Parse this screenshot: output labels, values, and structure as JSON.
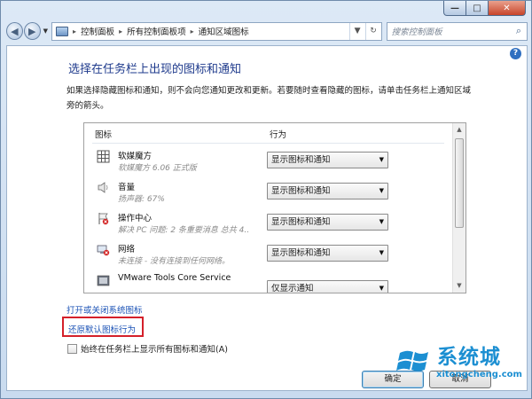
{
  "window": {
    "caption_min": "—",
    "caption_max": "□",
    "caption_close": "✕"
  },
  "nav": {
    "back_glyph": "◀",
    "forward_glyph": "▶",
    "breadcrumbs": [
      "控制面板",
      "所有控制面板项",
      "通知区域图标"
    ],
    "separator": "▸",
    "refresh_glyph": "↻",
    "search_placeholder": "搜索控制面板"
  },
  "content": {
    "title": "选择在任务栏上出现的图标和通知",
    "description": "如果选择隐藏图标和通知，则不会向您通知更改和更新。若要随时查看隐藏的图标，请单击任务栏上通知区域旁的箭头。",
    "columns": {
      "icon": "图标",
      "action": "行为"
    },
    "rows": [
      {
        "name": "软媒魔方",
        "sub": "软媒魔方 6.06 正式版",
        "action": "显示图标和通知",
        "icon": "grid-icon"
      },
      {
        "name": "音量",
        "sub": "扬声器: 67%",
        "action": "显示图标和通知",
        "icon": "speaker-icon"
      },
      {
        "name": "操作中心",
        "sub": "解决 PC 问题: 2 条重要消息 总共 4...",
        "action": "显示图标和通知",
        "icon": "flag-icon"
      },
      {
        "name": "网络",
        "sub": "未连接 - 没有连接到任何网络。",
        "action": "显示图标和通知",
        "icon": "network-icon"
      },
      {
        "name": "VMware Tools Core Service",
        "sub": "",
        "action": "仅显示通知",
        "icon": "vmware-icon"
      }
    ],
    "link_system_icons": "打开或关闭系统图标",
    "link_restore": "还原默认图标行为",
    "checkbox_label": "始终在任务栏上显示所有图标和通知(A)",
    "checkbox_checked": false,
    "ok_label": "确定",
    "cancel_label": "取消"
  },
  "watermark": {
    "text": "系统城",
    "url": "xitongcheng.com"
  },
  "colors": {
    "title": "#1e3a8c",
    "link": "#1c53b6",
    "highlight_box": "#d4202a",
    "watermark": "#1c8fd2"
  }
}
